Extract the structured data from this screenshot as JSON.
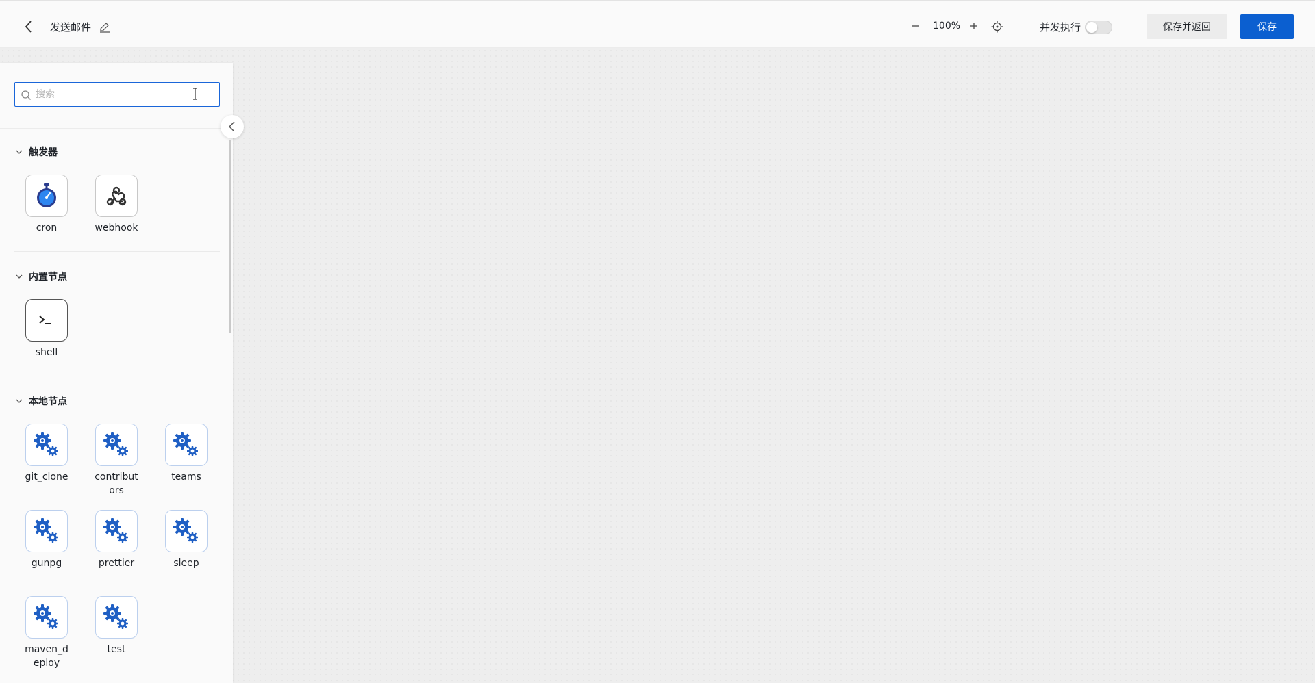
{
  "header": {
    "title": "发送邮件",
    "zoom_level": "100%",
    "concurrent_label": "并发执行",
    "concurrent_enabled": false,
    "save_return_label": "保存并返回",
    "save_label": "保存",
    "primary_color": "#0b5fd0"
  },
  "sidebar": {
    "search": {
      "placeholder": "搜索",
      "value": ""
    },
    "sections": [
      {
        "title": "触发器",
        "expanded": true,
        "nodes": [
          {
            "label": "cron",
            "icon": "stopwatch-icon"
          },
          {
            "label": "webhook",
            "icon": "webhook-icon"
          }
        ]
      },
      {
        "title": "内置节点",
        "expanded": true,
        "nodes": [
          {
            "label": "shell",
            "icon": "terminal-icon"
          }
        ]
      },
      {
        "title": "本地节点",
        "expanded": true,
        "nodes": [
          {
            "label": "git_clone",
            "icon": "gears-icon"
          },
          {
            "label": "contributors",
            "icon": "gears-icon"
          },
          {
            "label": "teams",
            "icon": "gears-icon"
          },
          {
            "label": "gunpg",
            "icon": "gears-icon"
          },
          {
            "label": "prettier",
            "icon": "gears-icon"
          },
          {
            "label": "sleep",
            "icon": "gears-icon"
          },
          {
            "label": "maven_deploy",
            "icon": "gears-icon"
          },
          {
            "label": "test",
            "icon": "gears-icon"
          }
        ]
      }
    ]
  }
}
